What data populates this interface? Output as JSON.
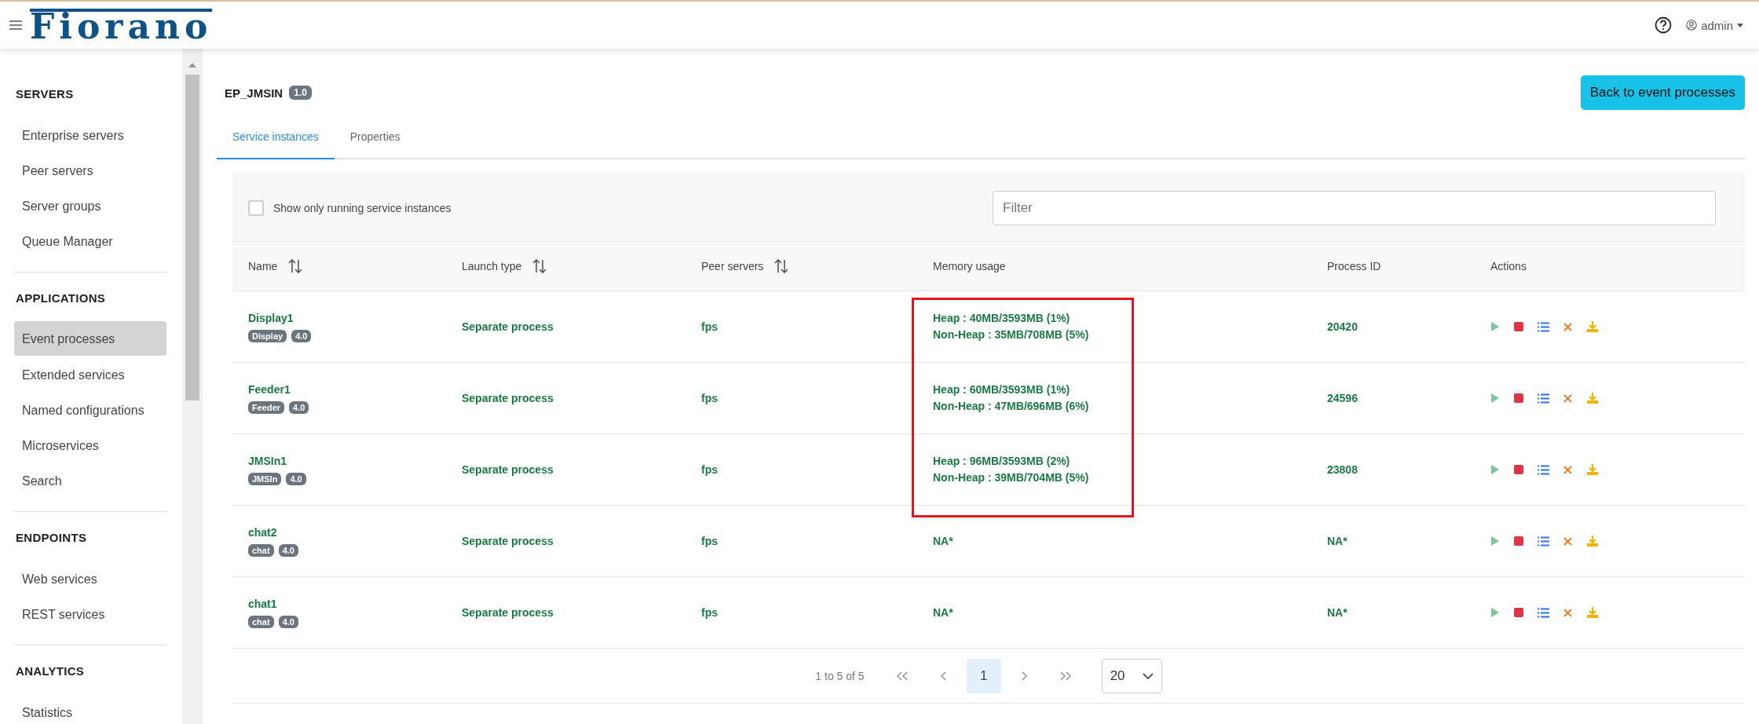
{
  "header": {
    "logo": "Fiorano",
    "user": "admin"
  },
  "sidebar": {
    "sections": [
      {
        "title": "SERVERS",
        "items": [
          {
            "label": "Enterprise servers",
            "selected": false
          },
          {
            "label": "Peer servers",
            "selected": false
          },
          {
            "label": "Server groups",
            "selected": false
          },
          {
            "label": "Queue Manager",
            "selected": false
          }
        ]
      },
      {
        "title": "APPLICATIONS",
        "items": [
          {
            "label": "Event processes",
            "selected": true
          },
          {
            "label": "Extended services",
            "selected": false
          },
          {
            "label": "Named configurations",
            "selected": false
          },
          {
            "label": "Microservices",
            "selected": false
          },
          {
            "label": "Search",
            "selected": false
          }
        ]
      },
      {
        "title": "ENDPOINTS",
        "items": [
          {
            "label": "Web services",
            "selected": false
          },
          {
            "label": "REST services",
            "selected": false
          }
        ]
      },
      {
        "title": "ANALYTICS",
        "items": [
          {
            "label": "Statistics",
            "selected": false
          }
        ]
      }
    ]
  },
  "page": {
    "title": "EP_JMSIN",
    "version": "1.0",
    "back_button": "Back to event processes"
  },
  "tabs": [
    {
      "label": "Service instances",
      "selected": true
    },
    {
      "label": "Properties",
      "selected": false
    }
  ],
  "filter": {
    "checkbox_label": "Show only running service instances",
    "checked": false,
    "placeholder": "Filter"
  },
  "table": {
    "columns": [
      {
        "label": "Name",
        "sortable": true
      },
      {
        "label": "Launch type",
        "sortable": true
      },
      {
        "label": "Peer servers",
        "sortable": true
      },
      {
        "label": "Memory usage",
        "sortable": false
      },
      {
        "label": "Process ID",
        "sortable": false
      },
      {
        "label": "Actions",
        "sortable": false
      }
    ],
    "rows": [
      {
        "name": "Display1",
        "badges": [
          "Display",
          "4.0"
        ],
        "launch_type": "Separate process",
        "peer_servers": "fps",
        "memory": [
          "Heap : 40MB/3593MB (1%)",
          "Non-Heap : 35MB/708MB (5%)"
        ],
        "highlighted": true,
        "process_id": "20420"
      },
      {
        "name": "Feeder1",
        "badges": [
          "Feeder",
          "4.0"
        ],
        "launch_type": "Separate process",
        "peer_servers": "fps",
        "memory": [
          "Heap : 60MB/3593MB (1%)",
          "Non-Heap : 47MB/696MB (6%)"
        ],
        "highlighted": true,
        "process_id": "24596"
      },
      {
        "name": "JMSIn1",
        "badges": [
          "JMSIn",
          "4.0"
        ],
        "launch_type": "Separate process",
        "peer_servers": "fps",
        "memory": [
          "Heap : 96MB/3593MB (2%)",
          "Non-Heap : 39MB/704MB (5%)"
        ],
        "highlighted": true,
        "process_id": "23808"
      },
      {
        "name": "chat2",
        "badges": [
          "chat",
          "4.0"
        ],
        "launch_type": "Separate process",
        "peer_servers": "fps",
        "memory": [
          "NA*"
        ],
        "highlighted": false,
        "process_id": "NA*"
      },
      {
        "name": "chat1",
        "badges": [
          "chat",
          "4.0"
        ],
        "launch_type": "Separate process",
        "peer_servers": "fps",
        "memory": [
          "NA*"
        ],
        "highlighted": false,
        "process_id": "NA*"
      }
    ]
  },
  "pagination": {
    "summary": "1 to 5 of 5",
    "pages": [
      {
        "label": "1",
        "selected": true
      }
    ],
    "page_size": "20"
  }
}
